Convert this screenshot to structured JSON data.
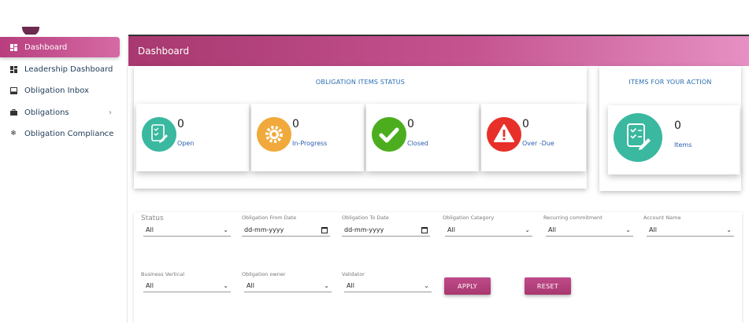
{
  "sidebar": {
    "items": [
      {
        "label": "Dashboard",
        "icon": "dashboard-grid-icon"
      },
      {
        "label": "Leadership Dashboard",
        "icon": "dashboard-grid-icon"
      },
      {
        "label": "Obligation Inbox",
        "icon": "inbox-icon"
      },
      {
        "label": "Obligations",
        "icon": "briefcase-icon"
      },
      {
        "label": "Obligation Compliance",
        "icon": "snowflake-icon"
      }
    ]
  },
  "header": {
    "title": "Dashboard"
  },
  "status_card": {
    "title": "OBLIGATION ITEMS STATUS",
    "stats": [
      {
        "value": "0",
        "label": "Open",
        "color": "#3ab8a0",
        "icon": "checklist-icon"
      },
      {
        "value": "0",
        "label": "In-Progress",
        "color": "#f0a93a",
        "icon": "gear-icon"
      },
      {
        "value": "0",
        "label": "Closed",
        "color": "#4cae1e",
        "icon": "check-icon"
      },
      {
        "value": "0",
        "label": "Over -Due",
        "color": "#e8302a",
        "icon": "alert-icon"
      }
    ]
  },
  "action_card": {
    "title": "ITEMS FOR YOUR ACTION",
    "value": "0",
    "label": "Items",
    "color": "#3ab8a0"
  },
  "filters": {
    "status": {
      "label": "Status",
      "value": "All"
    },
    "from_date": {
      "label": "Obligation From Date",
      "value": "dd-mm-yyyy"
    },
    "to_date": {
      "label": "Obligation To Date",
      "value": "dd-mm-yyyy"
    },
    "category": {
      "label": "Obligation Category",
      "value": "All"
    },
    "recurring": {
      "label": "Recurring commitment",
      "value": "All"
    },
    "account": {
      "label": "Account Name",
      "value": "All"
    },
    "vertical": {
      "label": "Business Vertical",
      "value": "All"
    },
    "owner": {
      "label": "Obligation owner",
      "value": "All"
    },
    "validator": {
      "label": "Validator",
      "value": "All"
    },
    "apply_label": "APPLY",
    "reset_label": "RESET"
  }
}
